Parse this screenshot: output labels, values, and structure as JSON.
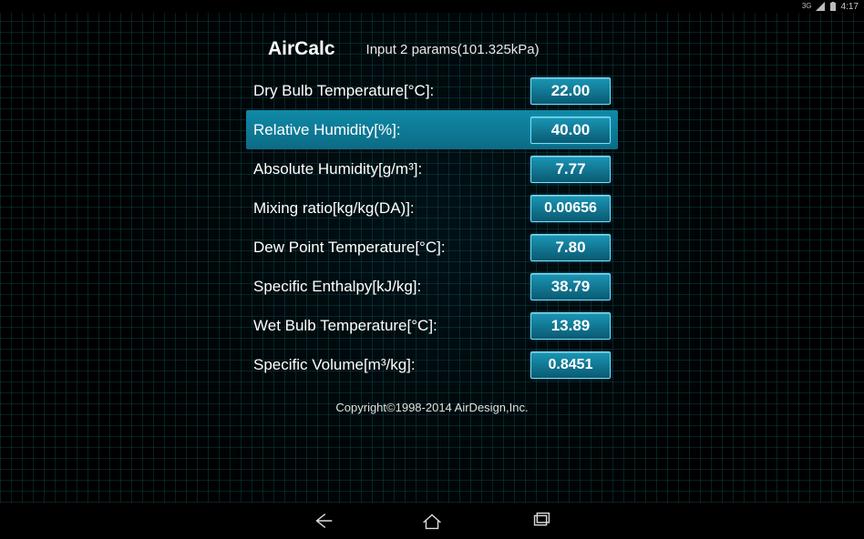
{
  "status": {
    "clock": "4:17",
    "icons": [
      {
        "name": "network-3g-icon",
        "glyph": "3G"
      },
      {
        "name": "signal-icon"
      },
      {
        "name": "battery-icon"
      }
    ]
  },
  "header": {
    "title": "AirCalc",
    "subtitle": "Input 2 params(101.325kPa)"
  },
  "rows": [
    {
      "label": "Dry Bulb Temperature[°C]:",
      "value": "22.00",
      "selected": false,
      "name": "dry-bulb-temperature"
    },
    {
      "label": "Relative Humidity[%]:",
      "value": "40.00",
      "selected": true,
      "name": "relative-humidity"
    },
    {
      "label": "Absolute Humidity[g/m³]:",
      "value": "7.77",
      "selected": false,
      "name": "absolute-humidity"
    },
    {
      "label": "Mixing ratio[kg/kg(DA)]:",
      "value": "0.00656",
      "selected": false,
      "name": "mixing-ratio"
    },
    {
      "label": "Dew Point Temperature[°C]:",
      "value": "7.80",
      "selected": false,
      "name": "dew-point-temperature"
    },
    {
      "label": "Specific Enthalpy[kJ/kg]:",
      "value": "38.79",
      "selected": false,
      "name": "specific-enthalpy"
    },
    {
      "label": "Wet Bulb Temperature[°C]:",
      "value": "13.89",
      "selected": false,
      "name": "wet-bulb-temperature"
    },
    {
      "label": "Specific Volume[m³/kg]:",
      "value": "0.8451",
      "selected": false,
      "name": "specific-volume"
    }
  ],
  "footer": "Copyright©1998-2014 AirDesign,Inc.",
  "nav": {
    "back": "back-icon",
    "home": "home-icon",
    "recent": "recent-icon"
  }
}
